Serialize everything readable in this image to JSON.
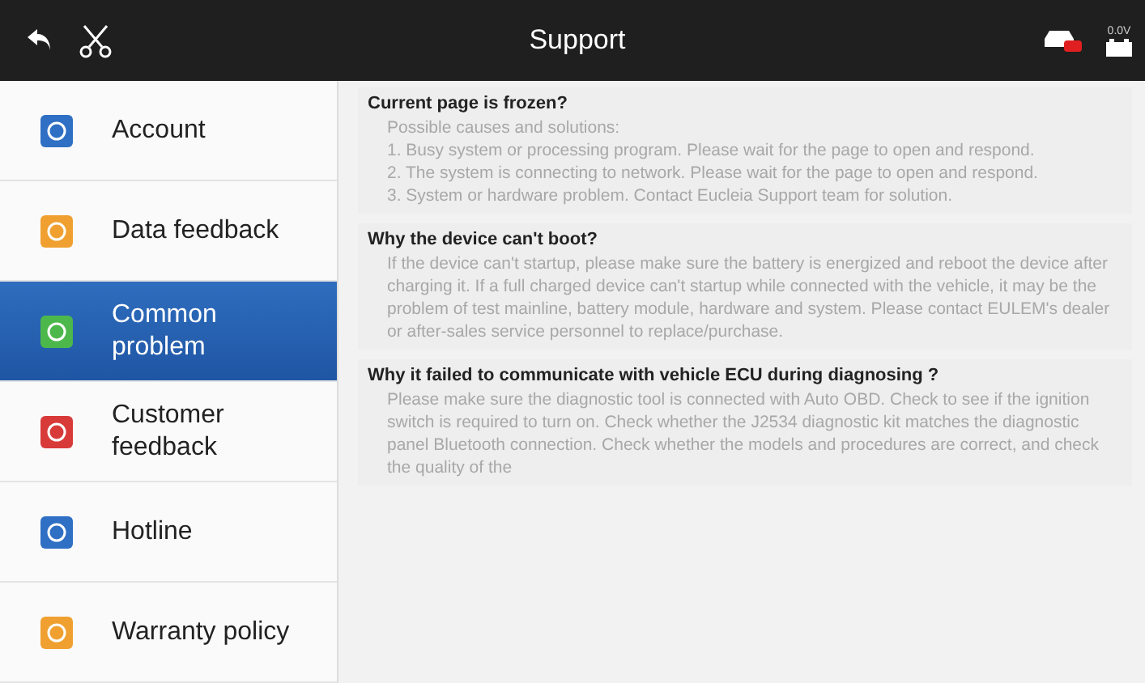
{
  "top_bar": {
    "title": "Support",
    "voltage": "0.0V"
  },
  "sidebar": {
    "items": [
      {
        "label": "Account",
        "kind": "account",
        "selected": false
      },
      {
        "label": "Data feedback",
        "kind": "data",
        "selected": false
      },
      {
        "label": "Common problem",
        "kind": "problem",
        "selected": true
      },
      {
        "label": "Customer feedback",
        "kind": "customer",
        "selected": false
      },
      {
        "label": "Hotline",
        "kind": "hotline",
        "selected": false
      },
      {
        "label": "Warranty policy",
        "kind": "data",
        "selected": false
      }
    ]
  },
  "faq": [
    {
      "question": "Current page is frozen?",
      "answer": [
        "Possible causes and solutions:",
        "1. Busy system or processing program. Please wait for the page to open and respond.",
        "2. The system is connecting to network. Please wait for the page to open and respond.",
        "3. System or hardware problem. Contact Eucleia Support team for solution."
      ]
    },
    {
      "question": "Why the device can't boot?",
      "answer": [
        "If the device can't startup, please make sure the battery is energized and reboot the device after charging it. If a full charged device can't startup while connected with the vehicle, it may be the problem of test mainline, battery module, hardware and system. Please contact EULEM's dealer or after-sales service personnel to replace/purchase."
      ]
    },
    {
      "question": "Why it failed to communicate with vehicle ECU during diagnosing ?",
      "answer": [
        "Please make sure the diagnostic tool is connected with Auto OBD. Check to see if the ignition switch is required to turn on. Check whether the J2534 diagnostic kit matches the diagnostic panel Bluetooth connection. Check whether the models and procedures are correct, and check the quality of the"
      ]
    }
  ]
}
